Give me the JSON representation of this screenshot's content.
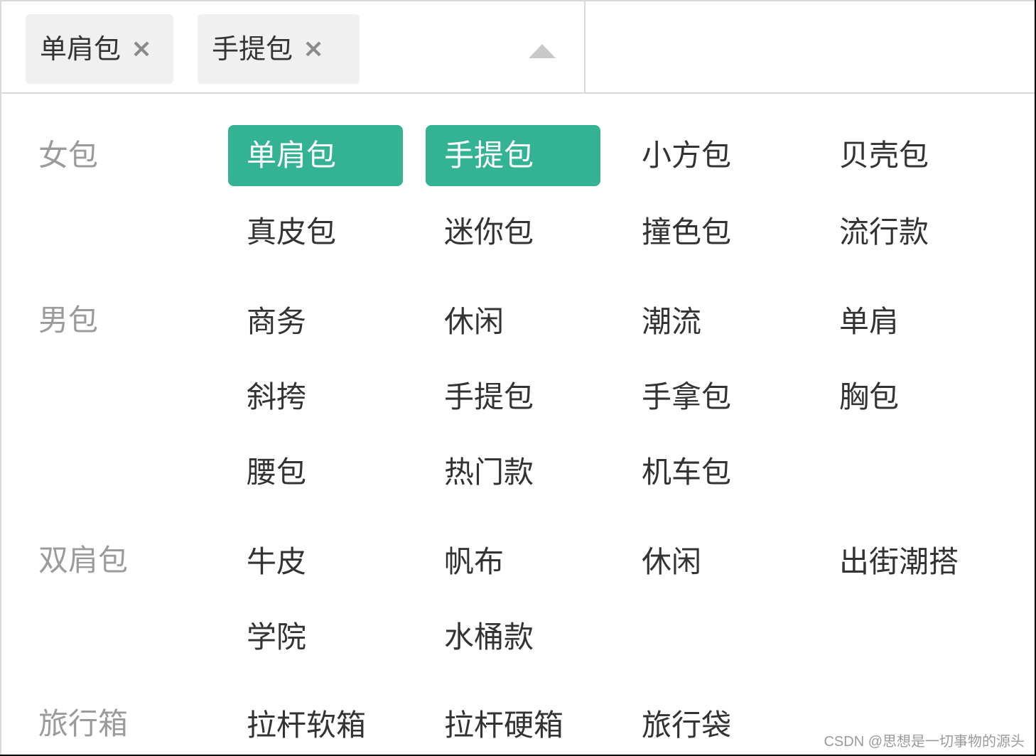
{
  "select": {
    "tags": [
      {
        "label": "单肩包",
        "close_icon": "×"
      },
      {
        "label": "手提包",
        "close_icon": "×"
      }
    ],
    "arrow_icon": "arrow-up-icon"
  },
  "accent_color": "#33b394",
  "groups": [
    {
      "title": "女包",
      "options": [
        {
          "label": "单肩包",
          "selected": true
        },
        {
          "label": "手提包",
          "selected": true
        },
        {
          "label": "小方包",
          "selected": false
        },
        {
          "label": "贝壳包",
          "selected": false
        },
        {
          "label": "真皮包",
          "selected": false
        },
        {
          "label": "迷你包",
          "selected": false
        },
        {
          "label": "撞色包",
          "selected": false
        },
        {
          "label": "流行款",
          "selected": false
        }
      ]
    },
    {
      "title": "男包",
      "options": [
        {
          "label": "商务",
          "selected": false
        },
        {
          "label": "休闲",
          "selected": false
        },
        {
          "label": "潮流",
          "selected": false
        },
        {
          "label": "单肩",
          "selected": false
        },
        {
          "label": "斜挎",
          "selected": false
        },
        {
          "label": "手提包",
          "selected": false
        },
        {
          "label": "手拿包",
          "selected": false
        },
        {
          "label": "胸包",
          "selected": false
        },
        {
          "label": "腰包",
          "selected": false
        },
        {
          "label": "热门款",
          "selected": false
        },
        {
          "label": "机车包",
          "selected": false
        }
      ]
    },
    {
      "title": "双肩包",
      "options": [
        {
          "label": "牛皮",
          "selected": false
        },
        {
          "label": "帆布",
          "selected": false
        },
        {
          "label": "休闲",
          "selected": false
        },
        {
          "label": "出街潮搭",
          "selected": false
        },
        {
          "label": "学院",
          "selected": false
        },
        {
          "label": "水桶款",
          "selected": false
        }
      ]
    },
    {
      "title": "旅行箱",
      "options": [
        {
          "label": "拉杆软箱",
          "selected": false
        },
        {
          "label": "拉杆硬箱",
          "selected": false
        },
        {
          "label": "旅行袋",
          "selected": false
        }
      ]
    }
  ],
  "watermark": "CSDN @思想是一切事物的源头"
}
